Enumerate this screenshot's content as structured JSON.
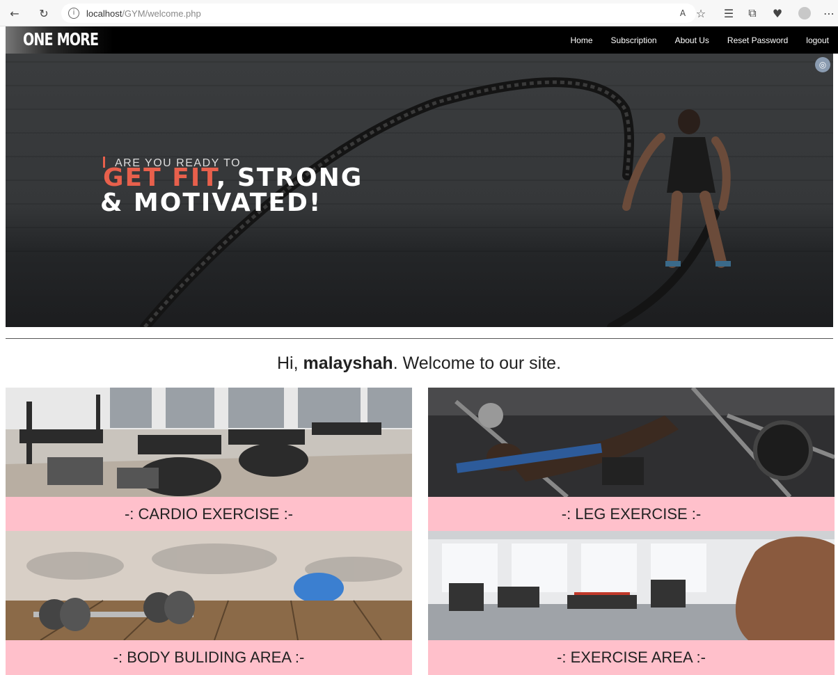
{
  "browser": {
    "url_host": "localhost",
    "url_path": "/GYM/welcome.php"
  },
  "navbar": {
    "logo_text": "ONE MORE",
    "links": [
      "Home",
      "Subscription",
      "About Us",
      "Reset Password",
      "logout"
    ]
  },
  "hero": {
    "line1": "ARE YOU READY TO",
    "line2_accent": "GET FIT",
    "line2_rest": ", STRONG",
    "line3": "& MOTIVATED!"
  },
  "welcome": {
    "prefix": "Hi, ",
    "username": "malayshah",
    "suffix": ". Welcome to our site."
  },
  "cards": [
    {
      "label": "-: CARDIO EXERCISE :-"
    },
    {
      "label": "-: LEG EXERCISE :-"
    },
    {
      "label": "-: BODY BULIDING AREA :-"
    },
    {
      "label": "-: EXERCISE AREA :-"
    }
  ],
  "colors": {
    "accent": "#e8604c",
    "card_label_bg": "#ffc0cb",
    "navbar_bg": "#000000"
  }
}
